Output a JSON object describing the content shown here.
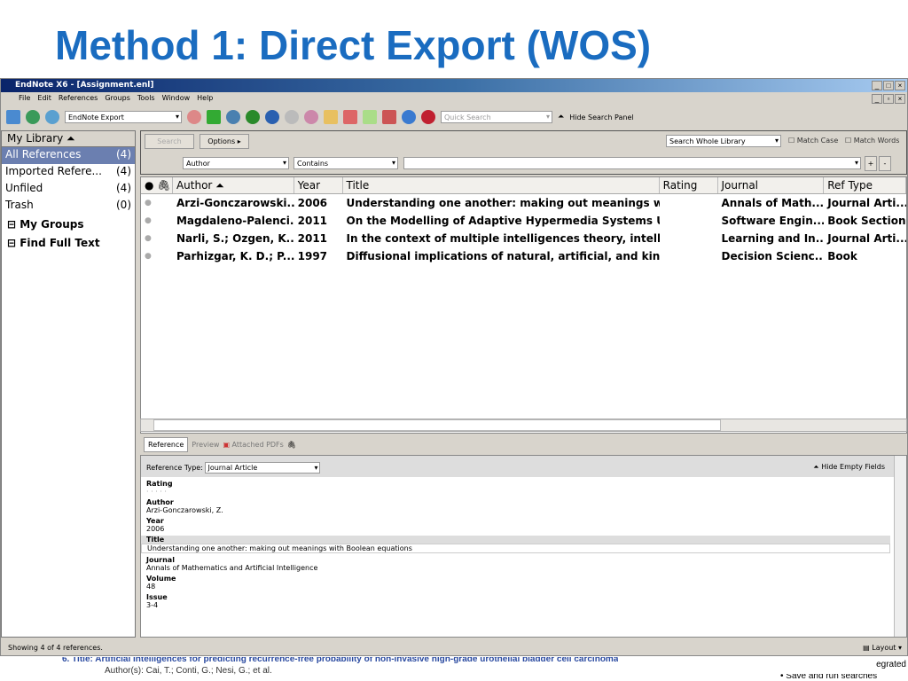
{
  "slide": {
    "title": "Method 1: Direct Export (WOS)"
  },
  "window": {
    "title": "EndNote X6 - [Assignment.enl]"
  },
  "menu": [
    "File",
    "Edit",
    "References",
    "Groups",
    "Tools",
    "Window",
    "Help"
  ],
  "toolbar": {
    "style": "EndNote Export",
    "quick_search_placeholder": "Quick Search",
    "hide_search_panel": "Hide Search Panel"
  },
  "sidebar": {
    "header": "My Library",
    "items": [
      {
        "label": "All References",
        "count": "(4)"
      },
      {
        "label": "Imported Refere...",
        "count": "(4)"
      },
      {
        "label": "Unfiled",
        "count": "(4)"
      },
      {
        "label": "Trash",
        "count": "(0)"
      }
    ],
    "groups": [
      "My Groups",
      "Find Full Text"
    ]
  },
  "search": {
    "search_btn": "Search",
    "options_btn": "Options",
    "scope": "Search Whole Library",
    "match_case": "Match Case",
    "match_words": "Match Words",
    "field": "Author",
    "operator": "Contains",
    "value": ""
  },
  "table": {
    "headers": [
      "Author",
      "Year",
      "Title",
      "Rating",
      "Journal",
      "Ref Type"
    ],
    "rows": [
      {
        "author": "Arzi-Gonczarowski...",
        "year": "2006",
        "title": "Understanding one another: making out meanings wit...",
        "rating": "",
        "journal": "Annals of Math...",
        "type": "Journal Arti..."
      },
      {
        "author": "Magdaleno-Palenci...",
        "year": "2011",
        "title": "On the Modelling of Adaptive Hypermedia Systems Usi...",
        "rating": "",
        "journal": "Software Engin...",
        "type": "Book Section"
      },
      {
        "author": "Narli, S.; Ozgen, K....",
        "year": "2011",
        "title": "In the context of multiple intelligences theory, intellig...",
        "rating": "",
        "journal": "Learning and In...",
        "type": "Journal Arti..."
      },
      {
        "author": "Parhizgar, K. D.; P...",
        "year": "1997",
        "title": "Diffusional implications of natural, artificial, and kinest...",
        "rating": "",
        "journal": "Decision Scienc...",
        "type": "Book"
      }
    ]
  },
  "tabs": [
    "Reference",
    "Preview",
    "Attached PDFs"
  ],
  "reference": {
    "type_label": "Reference Type:",
    "type": "Journal Article",
    "hide_empty": "Hide Empty Fields",
    "rating_label": "Rating",
    "rating_dots": "·  ·  ·  ·  ·",
    "fields": [
      {
        "label": "Author",
        "value": "Arzi-Gonczarowski, Z."
      },
      {
        "label": "Year",
        "value": "2006"
      },
      {
        "label": "Title",
        "value": "Understanding one another: making out meanings with Boolean equations"
      },
      {
        "label": "Journal",
        "value": "Annals of Mathematics and Artificial Intelligence"
      },
      {
        "label": "Volume",
        "value": "48"
      },
      {
        "label": "Issue",
        "value": "3-4"
      }
    ]
  },
  "status": {
    "text": "Showing 4 of 4 references.",
    "layout": "Layout"
  },
  "background": {
    "num": "6.",
    "title": "Title: Artificial intelligences for predicting recurrence-free probability of non-invasive high-grade urothelial bladder cell carcinoma",
    "authors": "Author(s): Cai, T.; Conti, G.; Nesi, G.; et al.",
    "side": "egrated",
    "side2": "Save and run searches"
  }
}
